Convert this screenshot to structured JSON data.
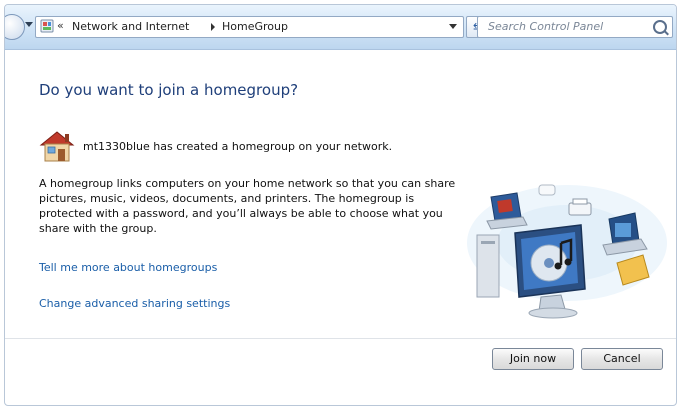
{
  "address_bar": {
    "breadcrumbs": [
      "Network and Internet",
      "HomeGroup"
    ],
    "prefix": "«"
  },
  "search": {
    "placeholder": "Search Control Panel"
  },
  "main": {
    "title": "Do you want to join a homegroup?",
    "created_message": "mt1330blue has created a homegroup on your network.",
    "description": "A homegroup links computers on your home network so that you can share pictures, music, videos, documents, and printers. The homegroup is protected with a password, and you’ll always be able to choose what you share with the group.",
    "links": {
      "tell_me_more": "Tell me more about homegroups",
      "advanced_sharing": "Change advanced sharing settings"
    }
  },
  "buttons": {
    "join": "Join now",
    "cancel": "Cancel"
  },
  "icons": {
    "back": "back-arrow-icon",
    "control_panel": "control-panel-icon",
    "refresh": "refresh-icon",
    "search": "search-icon",
    "homegroup": "house-icon"
  },
  "colors": {
    "title": "#1f3f7a",
    "link": "#1a5ea8",
    "chrome": "#cfe3f6"
  }
}
